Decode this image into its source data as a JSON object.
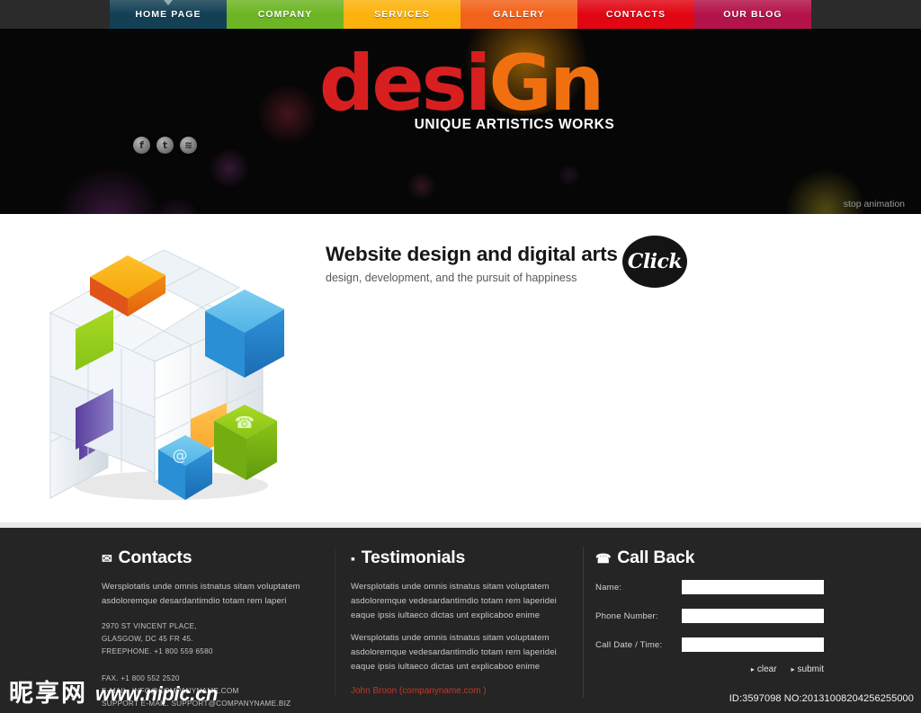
{
  "nav": {
    "items": [
      {
        "label": "HOME PAGE",
        "color": "#134054",
        "active": true
      },
      {
        "label": "COMPANY",
        "color": "#6db524",
        "active": false
      },
      {
        "label": "SERVICES",
        "color": "#fbb20b",
        "active": false
      },
      {
        "label": "GALLERY",
        "color": "#f2621a",
        "active": false
      },
      {
        "label": "CONTACTS",
        "color": "#e20613",
        "active": false
      },
      {
        "label": "OUR BLOG",
        "color": "#b3134a",
        "active": false
      }
    ]
  },
  "banner": {
    "logo": {
      "part1": "d",
      "part2": "esi",
      "part3": "Gn"
    },
    "tagline": "UNIQUE ARTISTICS WORKS",
    "socials": [
      {
        "name": "facebook-icon",
        "glyph": "f"
      },
      {
        "name": "twitter-icon",
        "glyph": "t"
      },
      {
        "name": "rss-icon",
        "glyph": "≋"
      }
    ],
    "stop_animation": "stop animation"
  },
  "main": {
    "title": "Website design and  digital arts",
    "subtitle": "design, development, and  the pursuit of happiness",
    "click_badge": "Click"
  },
  "footer": {
    "contacts": {
      "title": "Contacts",
      "icon": "envelope-icon",
      "lorem": "Wersplotatis unde omnis istnatus sitam voluptatem asdoloremque desardantimdio totam rem laperi",
      "address": [
        "2970 ST VINCENT PLACE,",
        "GLASGOW, DC 45 FR 45.",
        "FREEPHONE.  +1 800 559 6580"
      ],
      "lines": [
        "FAX.            +1 800 552 2520",
        "E-MAIL. INFO@COMPANYNAME.COM",
        "SUPPORT E-MAIL. SUPPORT@COMPANYNAME.BIZ"
      ]
    },
    "testimonials": {
      "title": "Testimonials",
      "icon": "speech-bubble-icon",
      "quotes": [
        "Wersplotatis unde omnis istnatus sitam voluptatem asdoloremque vedesardantimdio totam rem laperidei eaque ipsis iultaeco dictas unt explicaboo enime",
        "Wersplotatis unde omnis istnatus sitam voluptatem asdoloremque vedesardantimdio totam rem laperidei eaque ipsis iultaeco dictas unt explicaboo enime"
      ],
      "author": "John Broon (companyname.com )"
    },
    "callback": {
      "title": "Call Back",
      "icon": "phone-icon",
      "fields": [
        {
          "label": "Name:",
          "value": "",
          "placeholder": ""
        },
        {
          "label": "Phone Number:",
          "value": "",
          "placeholder": ""
        },
        {
          "label": "Call Date / Time:",
          "value": "",
          "placeholder": ""
        }
      ],
      "buttons": [
        {
          "label": "clear",
          "caret": "▸"
        },
        {
          "label": "submit",
          "caret": "▸"
        }
      ]
    }
  },
  "watermark": {
    "cn": "昵享网",
    "url": "www.nipic.cn"
  },
  "id_text": "ID:3597098 NO:20131008204256255000"
}
